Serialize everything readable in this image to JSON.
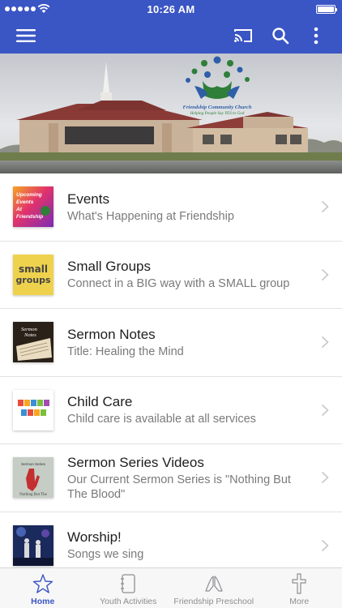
{
  "status_bar": {
    "time": "10:26 AM"
  },
  "app_bar": {
    "menu_icon": "hamburger-menu-icon",
    "cast_icon": "cast-icon",
    "search_icon": "search-icon",
    "more_icon": "more-vert-icon",
    "color": "#3a55c4"
  },
  "hero": {
    "logo_title": "Friendship Community Church",
    "logo_tagline": "Helping People Say YES to God"
  },
  "list": [
    {
      "title": "Events",
      "subtitle": "What's Happening at Friendship",
      "thumb_text": "Upcoming Events At Friendship"
    },
    {
      "title": "Small Groups",
      "subtitle": "Connect in a BIG way with a SMALL group",
      "thumb_text": "small groups"
    },
    {
      "title": "Sermon Notes",
      "subtitle": "Title: Healing the Mind",
      "thumb_text": "Sermon Notes"
    },
    {
      "title": "Child Care",
      "subtitle": "Child care is available at all services",
      "thumb_text": "CHILD CARE"
    },
    {
      "title": "Sermon Series Videos",
      "subtitle": "Our Current Sermon Series is \"Nothing But The Blood\"",
      "thumb_text": "Nothing But The"
    },
    {
      "title": "Worship!",
      "subtitle": "Songs we sing",
      "thumb_text": ""
    }
  ],
  "tabs": [
    {
      "label": "Home",
      "icon": "star-icon",
      "active": true
    },
    {
      "label": "Youth Activities",
      "icon": "notebook-icon",
      "active": false
    },
    {
      "label": "Friendship Preschool",
      "icon": "praying-hands-icon",
      "active": false
    },
    {
      "label": "More",
      "icon": "cross-icon",
      "active": false
    }
  ]
}
